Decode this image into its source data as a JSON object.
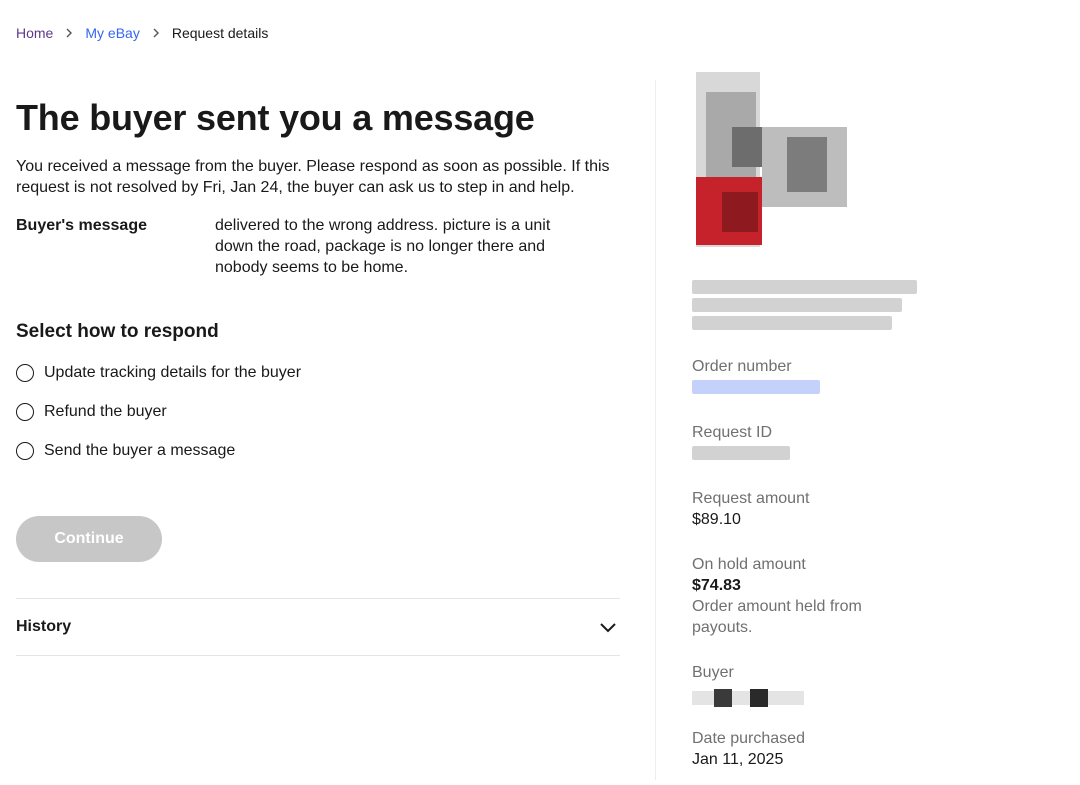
{
  "breadcrumb": {
    "home": "Home",
    "my_ebay": "My eBay",
    "current": "Request details"
  },
  "main": {
    "title": "The buyer sent you a message",
    "intro": "You received a message from the buyer. Please respond as soon as possible. If this request is not resolved by Fri, Jan 24, the buyer can ask us to step in and help.",
    "buyer_message_label": "Buyer's message",
    "buyer_message_text": "delivered to the wrong address. picture is a unit down the road, package is no longer there and nobody seems to be home.",
    "respond_title": "Select how to respond",
    "options": [
      {
        "label": "Update tracking details for the buyer"
      },
      {
        "label": "Refund the buyer"
      },
      {
        "label": "Send the buyer a message"
      }
    ],
    "continue_label": "Continue",
    "history_label": "History"
  },
  "sidebar": {
    "order_number_label": "Order number",
    "request_id_label": "Request ID",
    "request_amount_label": "Request amount",
    "request_amount_value": "$89.10",
    "on_hold_label": "On hold amount",
    "on_hold_value": "$74.83",
    "on_hold_note": "Order amount held from payouts.",
    "buyer_label": "Buyer",
    "date_purchased_label": "Date purchased",
    "date_purchased_value": "Jan 11, 2025"
  },
  "colors": {
    "link": "#3665f3",
    "home_link": "#5e3a8b",
    "disabled_button": "#c7c7c7",
    "muted_label": "#707070"
  }
}
